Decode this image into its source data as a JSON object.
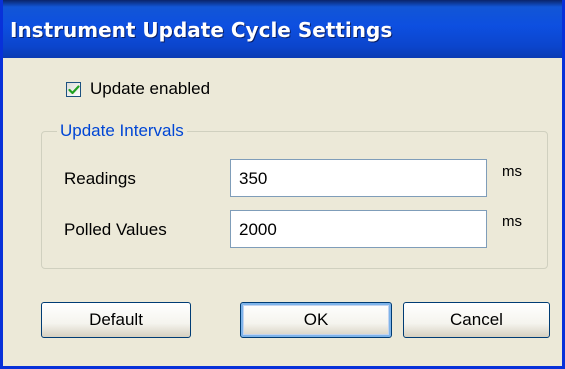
{
  "window": {
    "title": "Instrument Update Cycle Settings"
  },
  "update_enabled": {
    "label": "Update enabled",
    "checked": true
  },
  "group": {
    "title": "Update Intervals",
    "readings": {
      "label": "Readings",
      "value": "350",
      "unit": "ms"
    },
    "polled": {
      "label": "Polled Values",
      "value": "2000",
      "unit": "ms"
    }
  },
  "buttons": {
    "default": "Default",
    "ok": "OK",
    "cancel": "Cancel"
  },
  "colors": {
    "titlebar": "#0b45cc",
    "group_title": "#0046d5",
    "window_bg": "#ece9d8",
    "check": "#21a121"
  }
}
